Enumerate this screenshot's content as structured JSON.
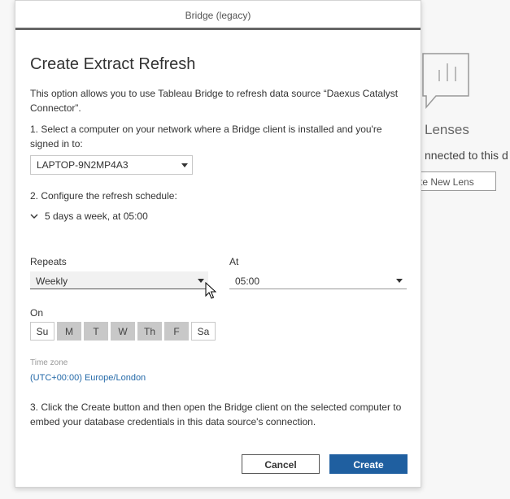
{
  "background": {
    "lens_title": "Lenses",
    "subtitle": "nnected to this d",
    "create_lens_button": "te New Lens"
  },
  "modal": {
    "header": "Bridge (legacy)",
    "title": "Create Extract Refresh",
    "description": "This option allows you to use Tableau Bridge to refresh data source “Daexus Catalyst Connector”.",
    "step1": "1. Select a computer on your network where a Bridge client is installed and you're signed in to:",
    "computer_select": "LAPTOP-9N2MP4A3",
    "step2": "2. Configure the refresh schedule:",
    "schedule_summary": "5 days a week, at 05:00",
    "repeats_label": "Repeats",
    "repeats_value": "Weekly",
    "at_label": "At",
    "at_value": "05:00",
    "on_label": "On",
    "days": [
      {
        "label": "Su",
        "selected": false
      },
      {
        "label": "M",
        "selected": true
      },
      {
        "label": "T",
        "selected": true
      },
      {
        "label": "W",
        "selected": true
      },
      {
        "label": "Th",
        "selected": true
      },
      {
        "label": "F",
        "selected": true
      },
      {
        "label": "Sa",
        "selected": false
      }
    ],
    "timezone_label": "Time zone",
    "timezone_value": "(UTC+00:00) Europe/London",
    "step3": "3. Click the Create button and then open the Bridge client on the selected computer to embed your database credentials in this data source's connection.",
    "cancel_label": "Cancel",
    "create_label": "Create"
  },
  "colors": {
    "primary_button": "#1f5fa0",
    "link": "#2469a8",
    "day_selected": "#c8c8c8"
  }
}
